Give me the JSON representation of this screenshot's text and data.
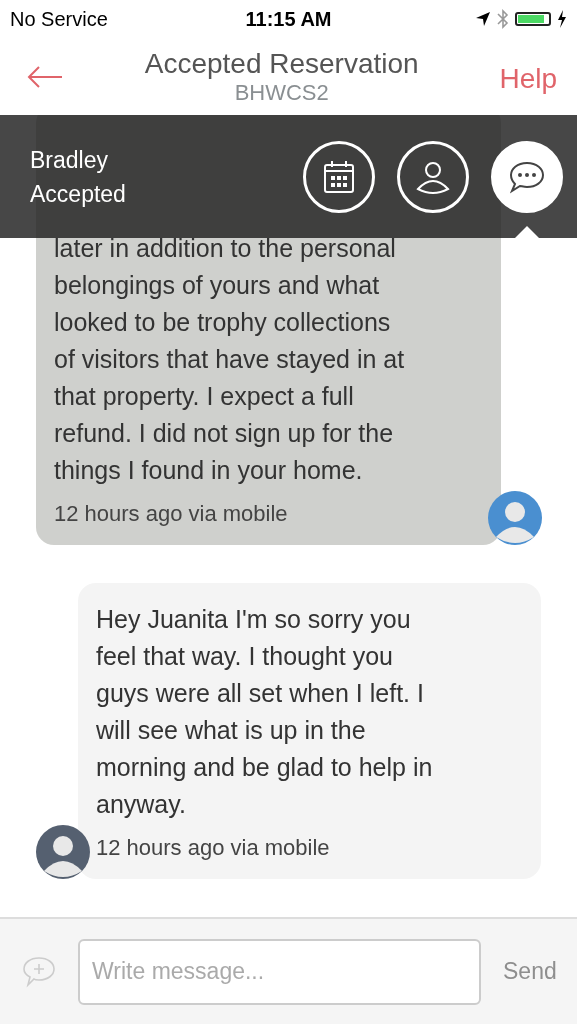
{
  "status_bar": {
    "carrier": "No Service",
    "time": "11:15 AM"
  },
  "header": {
    "title": "Accepted Reservation",
    "code": "BHWCS2",
    "help": "Help"
  },
  "overlay": {
    "name": "Bradley",
    "status": "Accepted",
    "tabs": [
      {
        "kind": "calendar",
        "selected": false
      },
      {
        "kind": "profile",
        "selected": false
      },
      {
        "kind": "messages",
        "selected": true
      }
    ]
  },
  "messages": [
    {
      "kind": "incoming",
      "text": "later in addition to the personal\nbelongings of yours and what\nlooked to be trophy collections\nof visitors that have stayed in at\nthat property. I expect a full\nrefund. I did not sign up for the\nthings I found in your home.",
      "meta": "12 hours ago via mobile"
    },
    {
      "kind": "outgoing",
      "text": "Hey Juanita I'm so sorry you\nfeel that way. I thought you\nguys were all set when I left. I\nwill see what is up in the\nmorning and be glad to help in\nanyway.",
      "meta": "12 hours ago via mobile"
    }
  ],
  "composer": {
    "placeholder": "Write message...",
    "send": "Send"
  }
}
